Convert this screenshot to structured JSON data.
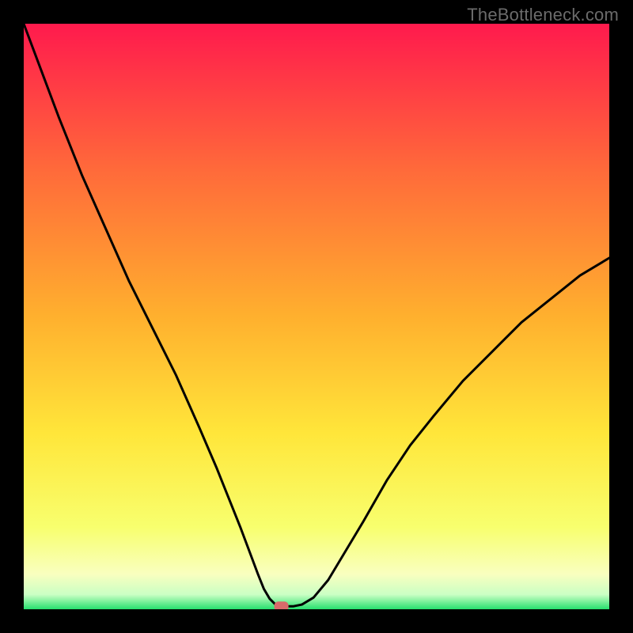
{
  "watermark": {
    "text": "TheBottleneck.com"
  },
  "chart_data": {
    "type": "line",
    "title": "",
    "xlabel": "",
    "ylabel": "",
    "xlim": [
      0,
      100
    ],
    "ylim": [
      0,
      100
    ],
    "grid": false,
    "legend": false,
    "background": {
      "type": "vertical-gradient",
      "stops": [
        {
          "pos": 0.0,
          "color": "#ff1a4d"
        },
        {
          "pos": 0.25,
          "color": "#ff6a3a"
        },
        {
          "pos": 0.5,
          "color": "#ffb02e"
        },
        {
          "pos": 0.7,
          "color": "#ffe63a"
        },
        {
          "pos": 0.86,
          "color": "#f8ff6e"
        },
        {
          "pos": 0.94,
          "color": "#f9ffbf"
        },
        {
          "pos": 0.975,
          "color": "#caffc4"
        },
        {
          "pos": 1.0,
          "color": "#26e06e"
        }
      ]
    },
    "series": [
      {
        "name": "bottleneck-curve",
        "color": "#000000",
        "x": [
          0,
          3,
          6,
          10,
          14,
          18,
          22,
          26,
          30,
          33,
          35,
          37,
          38.5,
          40,
          41,
          42,
          43,
          44,
          46,
          47.5,
          49.5,
          52,
          55,
          58,
          62,
          66,
          70,
          75,
          80,
          85,
          90,
          95,
          100
        ],
        "y": [
          100,
          92,
          84,
          74,
          65,
          56,
          48,
          40,
          31,
          24,
          19,
          14,
          10,
          6,
          3.5,
          1.8,
          0.8,
          0.5,
          0.5,
          0.8,
          2,
          5,
          10,
          15,
          22,
          28,
          33,
          39,
          44,
          49,
          53,
          57,
          60
        ]
      }
    ],
    "markers": [
      {
        "name": "optimal-point",
        "x": 44,
        "y": 0.5,
        "color": "#d86a6a",
        "shape": "rounded-rect"
      }
    ]
  }
}
